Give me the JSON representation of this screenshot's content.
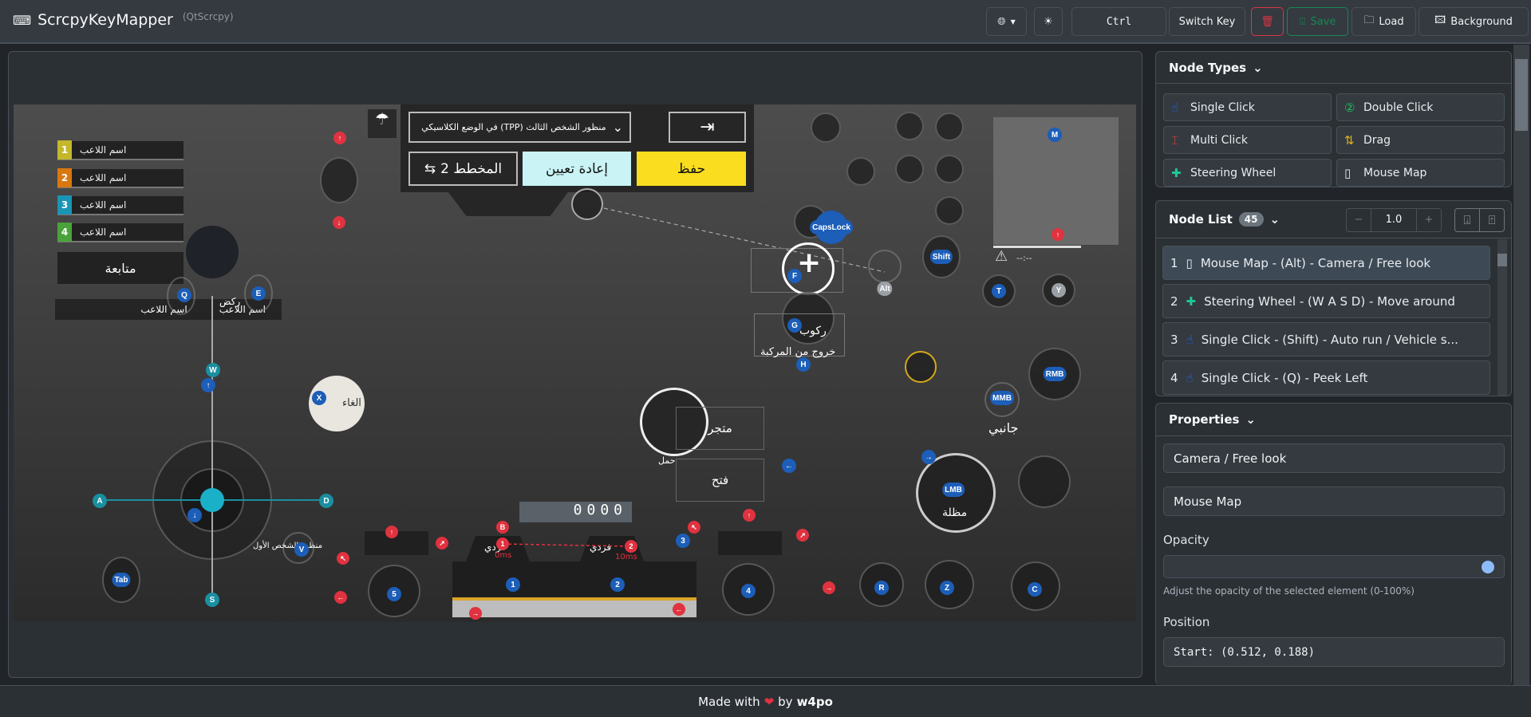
{
  "header": {
    "title": "ScrcpyKeyMapper",
    "subtitle": "(QtScrcpy)",
    "key_value": "Ctrl",
    "switch_key": "Switch Key",
    "save": "Save",
    "load": "Load",
    "background": "Background"
  },
  "colors": {
    "accent": "#0d6efd",
    "danger": "#dc3545",
    "success": "#198754",
    "key_badge": "#1c5eb8"
  },
  "game": {
    "mode_dropdown": "منظور الشخص الثالث (TPP) في الوضع الكلاسيكي",
    "layout_btn": "المخطط 2",
    "reset_btn": "إعادة تعيين",
    "save_btn": "حفظ",
    "players": [
      "اسم اللاعب",
      "اسم اللاعب",
      "اسم اللاعب",
      "اسم اللاعب"
    ],
    "follow": "متابعة",
    "team_player": "اسم اللاعب",
    "cancel": "الغاء",
    "shop": "متجر",
    "open": "فتح",
    "carry": "حمل",
    "side": "جانبي",
    "parachute": "مظلة",
    "ride": "ركوب",
    "exit_vehicle": "خروج من المركبة",
    "run": "ركض",
    "fpp": "منظور الشخص الأول",
    "single_fire": "فردي",
    "delay1": "0ms",
    "delay2": "10ms",
    "counter": "0000",
    "timer": "--:--",
    "keys": {
      "M": "M",
      "Q": "Q",
      "E": "E",
      "W": "W",
      "up": "↑",
      "X": "X",
      "A": "A",
      "D": "D",
      "down": "↓",
      "S": "S",
      "V": "V",
      "Tab": "Tab",
      "k5": "5",
      "B": "B",
      "r1": "1",
      "r2": "2",
      "b1": "1",
      "b2": "2",
      "k3": "3",
      "k4": "4",
      "R": "R",
      "Z": "Z",
      "C": "C",
      "LMB": "LMB",
      "right": "→",
      "left": "←",
      "MMB": "MMB",
      "RMB": "RMB",
      "H": "H",
      "G": "G",
      "F": "F",
      "Alt": "Alt",
      "Shift": "Shift",
      "CapsLock": "CapsLock",
      "T": "T",
      "Y": "Y"
    }
  },
  "node_types": {
    "title": "Node Types",
    "items": [
      {
        "label": "Single Click",
        "icon": "hand-pointer-icon",
        "color": "#1e6ef5"
      },
      {
        "label": "Double Click",
        "icon": "double-click-icon",
        "color": "#20c05c"
      },
      {
        "label": "Multi Click",
        "icon": "multi-click-icon",
        "color": "#e0443e"
      },
      {
        "label": "Drag",
        "icon": "drag-arrows-icon",
        "color": "#e8b416"
      },
      {
        "label": "Steering Wheel",
        "icon": "dpad-icon",
        "color": "#20c997"
      },
      {
        "label": "Mouse Map",
        "icon": "mouse-icon",
        "color": "#e9ecef"
      }
    ]
  },
  "node_list": {
    "title": "Node List",
    "count": "45",
    "scale": "1.0",
    "minus": "−",
    "plus": "+",
    "items": [
      {
        "index": "1",
        "icon": "mouse-icon",
        "text": "Mouse Map - (Alt) - Camera / Free look",
        "selected": true
      },
      {
        "index": "2",
        "icon": "dpad-icon",
        "text": "Steering Wheel - (W A S D) - Move around"
      },
      {
        "index": "3",
        "icon": "hand-pointer-icon",
        "text": "Single Click - (Shift) - Auto run / Vehicle s..."
      },
      {
        "index": "4",
        "icon": "hand-pointer-icon",
        "text": "Single Click - (Q) - Peek Left"
      }
    ]
  },
  "properties": {
    "title": "Properties",
    "comment": "Camera / Free look",
    "type": "Mouse Map",
    "opacity_label": "Opacity",
    "opacity_value": 100,
    "opacity_help": "Adjust the opacity of the selected element (0-100%)",
    "position_label": "Position",
    "position": "Start: (0.512, 0.188)"
  },
  "footer": {
    "made_with": "Made with",
    "by": "by",
    "author": "w4po"
  }
}
